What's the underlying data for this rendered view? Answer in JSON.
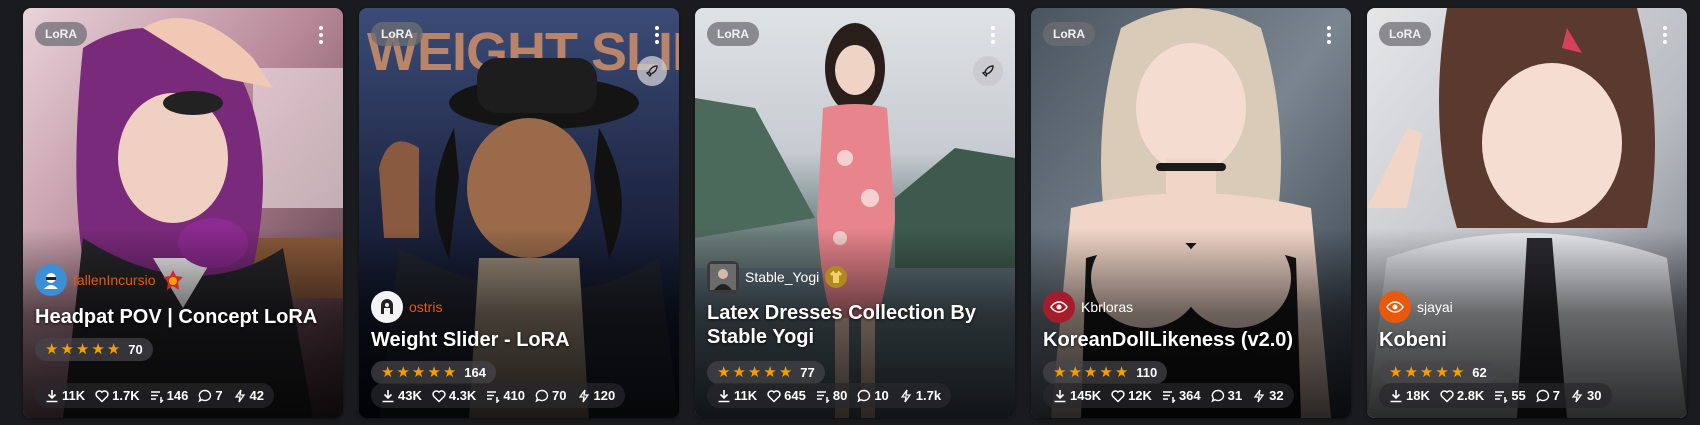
{
  "cards": [
    {
      "badge": "LoRA",
      "creator": "fallenIncursio",
      "title": "Headpat POV | Concept LoRA",
      "rating_count": "70",
      "stats": {
        "downloads": "11K",
        "likes": "1.7K",
        "comments_stack": "146",
        "comments": "7",
        "tips": "42"
      }
    },
    {
      "badge": "LoRA",
      "image_text": "WEIGHT SLIDER",
      "creator": "ostris",
      "title": "Weight Slider - LoRA",
      "rating_count": "164",
      "stats": {
        "downloads": "43K",
        "likes": "4.3K",
        "comments_stack": "410",
        "comments": "70",
        "tips": "120"
      }
    },
    {
      "badge": "LoRA",
      "creator": "Stable_Yogi",
      "title_lines": [
        "Latex Dresses Collection By",
        "Stable Yogi"
      ],
      "rating_count": "77",
      "stats": {
        "downloads": "11K",
        "likes": "645",
        "comments_stack": "80",
        "comments": "10",
        "tips": "1.7k"
      }
    },
    {
      "badge": "LoRA",
      "creator": "Kbrloras",
      "title": "KoreanDollLikeness (v2.0)",
      "rating_count": "110",
      "stats": {
        "downloads": "145K",
        "likes": "12K",
        "comments_stack": "364",
        "comments": "31",
        "tips": "32"
      }
    },
    {
      "badge": "LoRA",
      "creator": "sjayai",
      "title": "Kobeni",
      "rating_count": "62",
      "stats": {
        "downloads": "18K",
        "likes": "2.8K",
        "comments_stack": "55",
        "comments": "7",
        "tips": "30"
      }
    }
  ],
  "colors": {
    "background": "#1a1b1e",
    "star": "#f59f00",
    "creator_highlight": "#e8590c"
  }
}
